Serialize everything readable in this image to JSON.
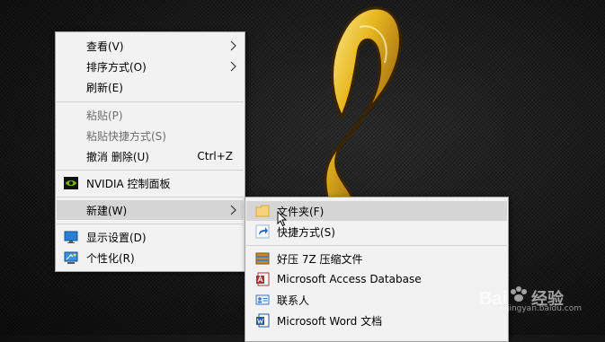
{
  "context_menu": {
    "items": [
      {
        "label": "查看(V)"
      },
      {
        "label": "排序方式(O)"
      },
      {
        "label": "刷新(E)"
      },
      {
        "label": "粘贴(P)"
      },
      {
        "label": "粘贴快捷方式(S)"
      },
      {
        "label": "撤消 删除(U)",
        "shortcut": "Ctrl+Z"
      },
      {
        "label": "NVIDIA 控制面板"
      },
      {
        "label": "新建(W)"
      },
      {
        "label": "显示设置(D)"
      },
      {
        "label": "个性化(R)"
      }
    ]
  },
  "new_submenu": {
    "items": [
      {
        "label": "文件夹(F)"
      },
      {
        "label": "快捷方式(S)"
      },
      {
        "label": "好压 7Z 压缩文件"
      },
      {
        "label": "Microsoft Access Database"
      },
      {
        "label": "联系人"
      },
      {
        "label": "Microsoft Word 文档"
      }
    ]
  },
  "watermark": {
    "brand": "Baidu经验",
    "url": "jingyan.baidu.com"
  },
  "colors": {
    "menu_bg": "#f2f2f2",
    "hover_bg": "#d6d6d6",
    "disabled_text": "#6d6d6d",
    "gold": "#e0b020"
  }
}
